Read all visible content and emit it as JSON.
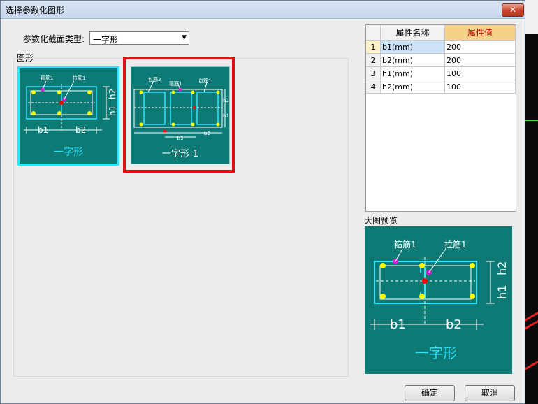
{
  "window": {
    "title": "选择参数化图形",
    "close_glyph": "✕"
  },
  "section_type": {
    "label": "参数化截面类型:",
    "selected": "一字形"
  },
  "figures_group": {
    "label": "图形"
  },
  "thumbnails": [
    {
      "caption": "一字形",
      "labels": {
        "stirrup": "箍筋1",
        "tie": "拉筋1",
        "b1": "b1",
        "b2": "b2",
        "h1": "h1",
        "h2": "h2"
      }
    },
    {
      "caption": "一字形-1",
      "labels": {
        "stirrup2": "包筋2",
        "stirrup1": "箍筋1",
        "outer": "包筋1",
        "b3": "b3",
        "b2": "b2",
        "h2": "h2",
        "h1": "h1"
      }
    }
  ],
  "properties": {
    "headers": [
      "",
      "属性名称",
      "属性值"
    ],
    "rows": [
      {
        "index": "1",
        "name": "b1(mm)",
        "value": "200"
      },
      {
        "index": "2",
        "name": "b2(mm)",
        "value": "200"
      },
      {
        "index": "3",
        "name": "h1(mm)",
        "value": "100"
      },
      {
        "index": "4",
        "name": "h2(mm)",
        "value": "100"
      }
    ]
  },
  "preview": {
    "label": "大图预览",
    "stirrup": "箍筋1",
    "tie": "拉筋1",
    "b1": "b1",
    "b2": "b2",
    "h1": "h1",
    "h2": "h2",
    "caption": "一字形"
  },
  "buttons": {
    "ok": "确定",
    "cancel": "取消"
  },
  "colors": {
    "thumb_bg": "#0d7a76",
    "bar": "#2fe3ff",
    "highlight": "#e01010",
    "header_value_bg": "#f5d28a"
  }
}
